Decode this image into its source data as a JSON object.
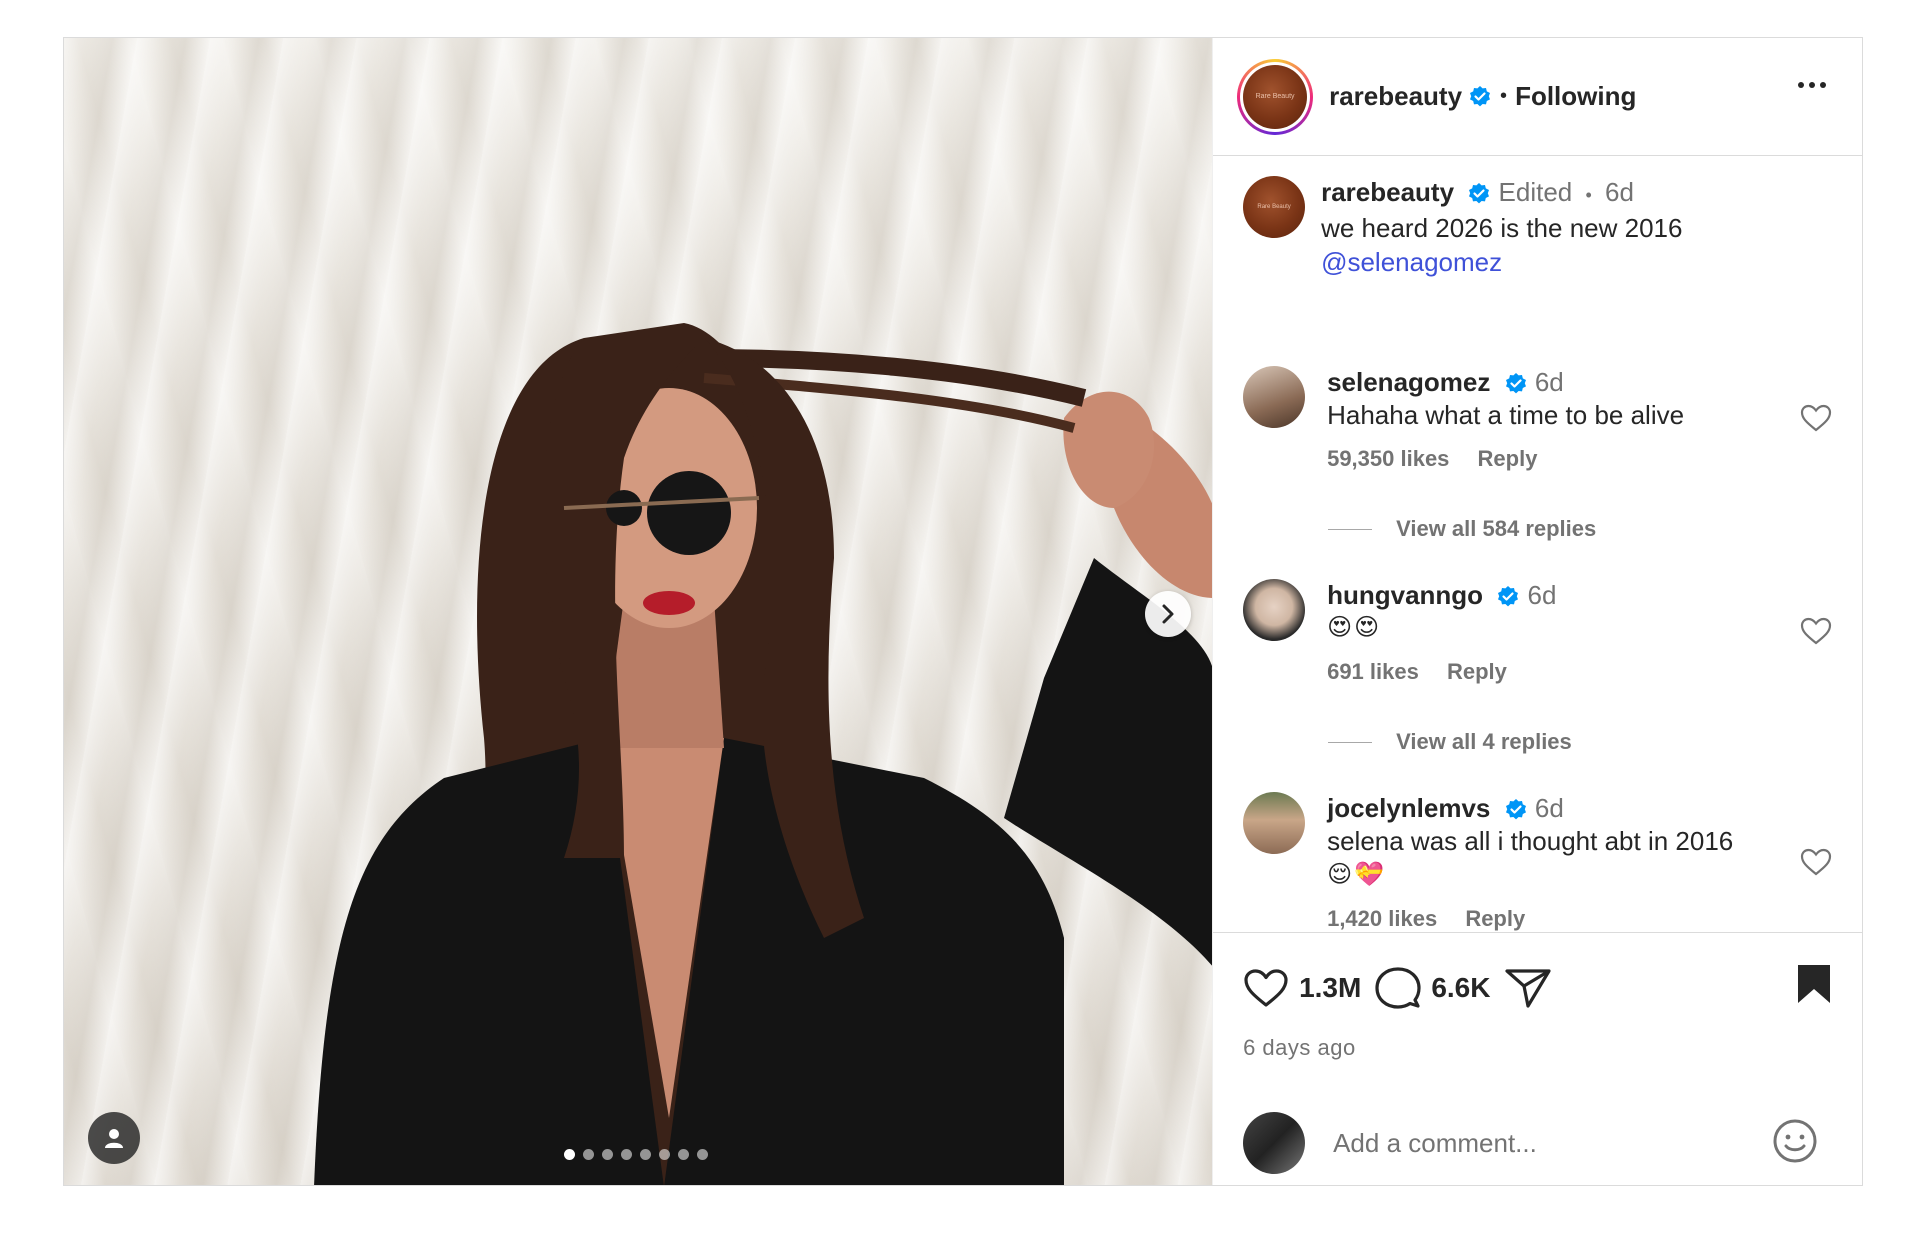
{
  "post": {
    "author": "rarebeauty",
    "follow_state": "Following",
    "separator": "•",
    "carousel": {
      "slides_total": 8,
      "current_slide": 1
    }
  },
  "caption": {
    "username": "rarebeauty",
    "edited": "Edited",
    "dot": "•",
    "time": "6d",
    "text": "we heard 2026 is the new 2016",
    "mention": "@selenagomez"
  },
  "comments": [
    {
      "username": "selenagomez",
      "time": "6d",
      "text": "Hahaha what a time to be alive",
      "likes": "59,350 likes",
      "reply": "Reply",
      "view_replies": "View all 584 replies"
    },
    {
      "username": "hungvanngo",
      "time": "6d",
      "text": "😍😍",
      "likes": "691 likes",
      "reply": "Reply",
      "view_replies": "View all 4 replies"
    },
    {
      "username": "jocelynlemvs",
      "time": "6d",
      "text": "selena was all i thought abt in 2016",
      "text2": "😌💝",
      "likes": "1,420 likes",
      "reply": "Reply"
    }
  ],
  "actions": {
    "like_count": "1.3M",
    "comment_count": "6.6K",
    "posted_ago": "6 days ago"
  },
  "composer": {
    "placeholder": "Add a comment..."
  },
  "colors": {
    "verified": "#0095f6",
    "mention": "#3f51d8",
    "muted": "#737373",
    "text": "#262626"
  },
  "icons": [
    "verified-badge-icon",
    "more-options-icon",
    "heart-icon",
    "comment-icon",
    "share-icon",
    "bookmark-icon",
    "emoji-icon",
    "chevron-right-icon",
    "user-tag-icon"
  ]
}
